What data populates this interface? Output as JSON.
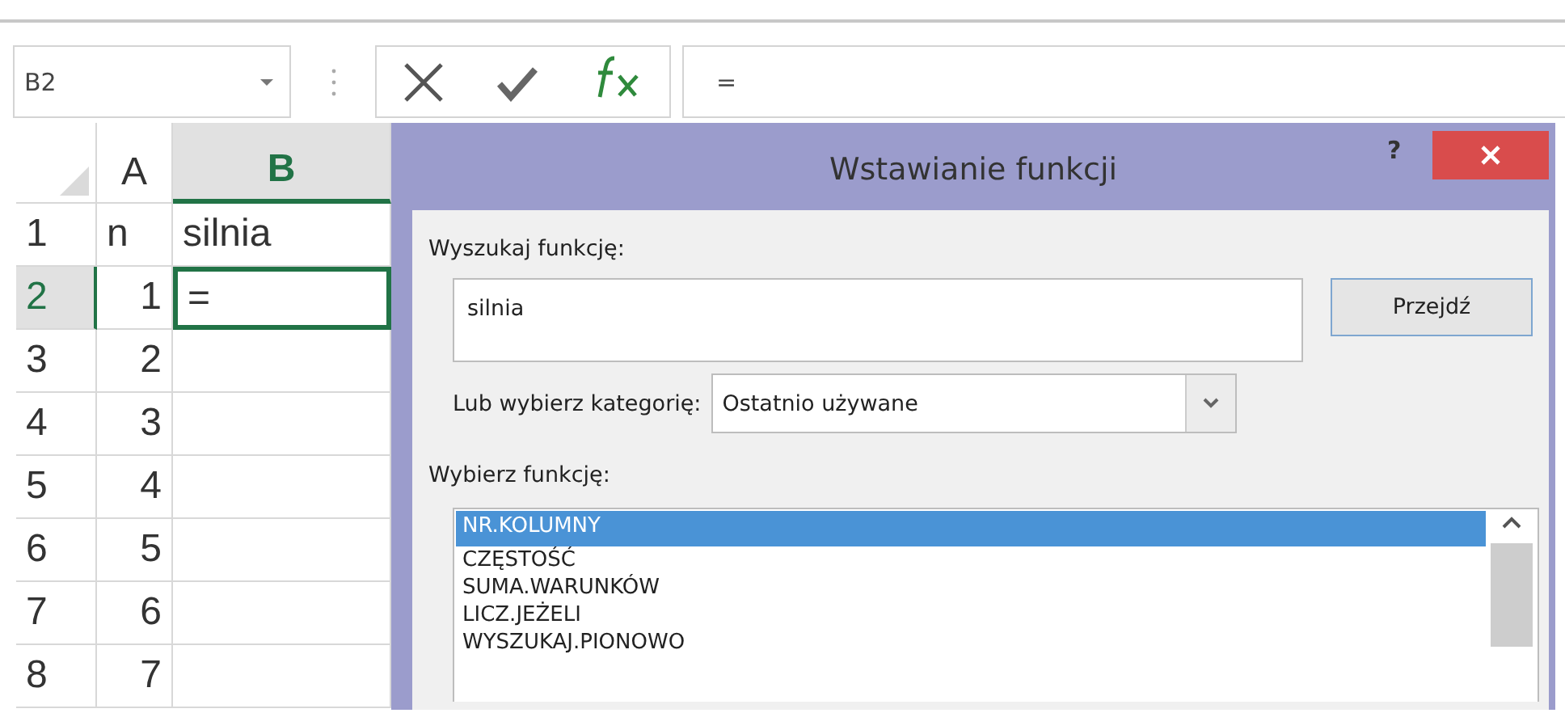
{
  "formula_bar": {
    "name_box": "B2",
    "formula": "="
  },
  "sheet": {
    "columns": [
      {
        "label": "A",
        "selected": false
      },
      {
        "label": "B",
        "selected": true
      }
    ],
    "rows": [
      {
        "number": "1",
        "selected": false,
        "cells": [
          {
            "text": "n",
            "kind": "text",
            "selected": false
          },
          {
            "text": "silnia",
            "kind": "text",
            "selected": false
          }
        ]
      },
      {
        "number": "2",
        "selected": true,
        "cells": [
          {
            "text": "1",
            "kind": "number",
            "selected": false
          },
          {
            "text": "=",
            "kind": "text",
            "selected": true
          }
        ]
      },
      {
        "number": "3",
        "selected": false,
        "cells": [
          {
            "text": "2",
            "kind": "number",
            "selected": false
          },
          {
            "selected": false
          }
        ]
      },
      {
        "number": "4",
        "selected": false,
        "cells": [
          {
            "text": "3",
            "kind": "number",
            "selected": false
          },
          {
            "selected": false
          }
        ]
      },
      {
        "number": "5",
        "selected": false,
        "cells": [
          {
            "text": "4",
            "kind": "number",
            "selected": false
          },
          {
            "selected": false
          }
        ]
      },
      {
        "number": "6",
        "selected": false,
        "cells": [
          {
            "text": "5",
            "kind": "number",
            "selected": false
          },
          {
            "selected": false
          }
        ]
      },
      {
        "number": "7",
        "selected": false,
        "cells": [
          {
            "text": "6",
            "kind": "number",
            "selected": false
          },
          {
            "selected": false
          }
        ]
      },
      {
        "number": "8",
        "selected": false,
        "cells": [
          {
            "text": "7",
            "kind": "number",
            "selected": false
          },
          {
            "selected": false
          }
        ]
      }
    ]
  },
  "dialog": {
    "title": "Wstawianie funkcji",
    "help": "?",
    "search_label": "Wyszukaj funkcję:",
    "search_value": "silnia",
    "go_button": "Przejdź",
    "category_label": "Lub wybierz kategorię:",
    "category_value": "Ostatnio używane",
    "list_label": "Wybierz funkcję:",
    "functions": [
      {
        "name": "NR.KOLUMNY",
        "selected": true
      },
      {
        "name": "CZĘSTOŚĆ",
        "selected": false
      },
      {
        "name": "SUMA.WARUNKÓW",
        "selected": false
      },
      {
        "name": "LICZ.JEŻELI",
        "selected": false
      },
      {
        "name": "WYSZUKAJ.PIONOWO",
        "selected": false
      }
    ]
  }
}
